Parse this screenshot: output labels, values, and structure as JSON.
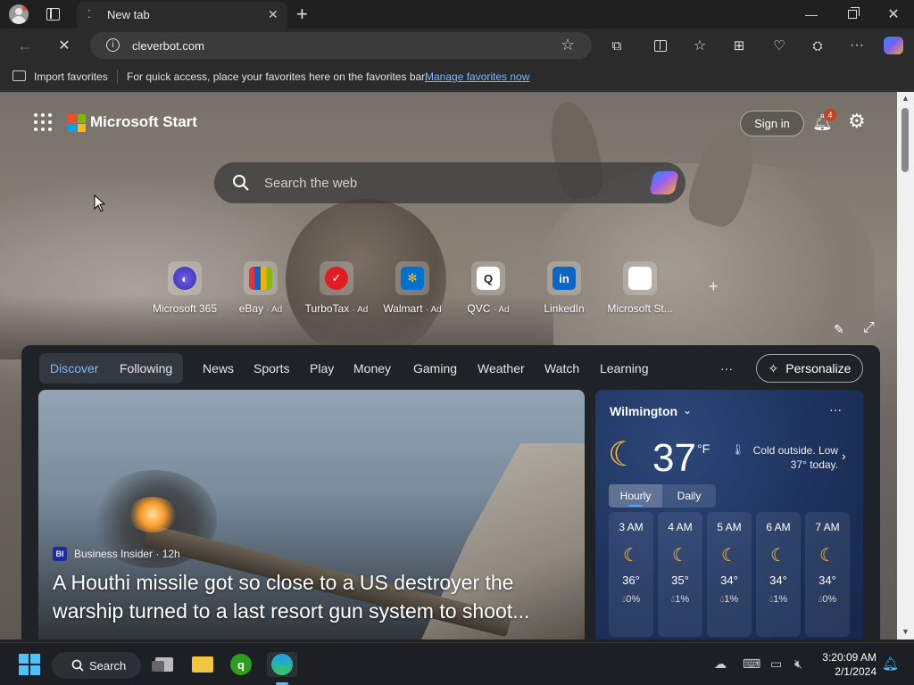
{
  "browser": {
    "tab_title": "New tab",
    "url": "cleverbot.com"
  },
  "favorites_bar": {
    "import_label": "Import favorites",
    "hint": "For quick access, place your favorites here on the favorites bar.",
    "manage_link": "Manage favorites now"
  },
  "header": {
    "brand": "Microsoft Start",
    "sign_in": "Sign in",
    "notification_count": "4"
  },
  "search": {
    "placeholder": "Search the web"
  },
  "quick_links": [
    {
      "label": "Microsoft 365",
      "ad": ""
    },
    {
      "label": "eBay",
      "ad": "· Ad"
    },
    {
      "label": "TurboTax",
      "ad": "· Ad"
    },
    {
      "label": "Walmart",
      "ad": "· Ad"
    },
    {
      "label": "QVC",
      "ad": "· Ad"
    },
    {
      "label": "LinkedIn",
      "ad": ""
    },
    {
      "label": "Microsoft St...",
      "ad": ""
    }
  ],
  "feed_nav": {
    "discover": "Discover",
    "following": "Following",
    "tabs": [
      "News",
      "Sports",
      "Play",
      "Money",
      "Gaming",
      "Weather",
      "Watch",
      "Learning"
    ],
    "more": "···",
    "personalize": "Personalize"
  },
  "hero": {
    "source_logo": "BI",
    "source": "Business Insider · 12h",
    "headline": "A Houthi missile got so close to a US destroyer the warship turned to a last resort gun system to shoot..."
  },
  "weather": {
    "location": "Wilmington",
    "temp": "37",
    "unit": "°F",
    "note": "Cold outside. Low 37° today.",
    "tab_hourly": "Hourly",
    "tab_daily": "Daily",
    "hours": [
      {
        "time": "3 AM",
        "temp": "36°",
        "precip": "0%"
      },
      {
        "time": "4 AM",
        "temp": "35°",
        "precip": "1%"
      },
      {
        "time": "5 AM",
        "temp": "34°",
        "precip": "1%"
      },
      {
        "time": "6 AM",
        "temp": "34°",
        "precip": "1%"
      },
      {
        "time": "7 AM",
        "temp": "34°",
        "precip": "0%"
      }
    ]
  },
  "taskbar": {
    "search_label": "Search",
    "time": "3:20:09 AM",
    "date": "2/1/2024"
  },
  "colors": {
    "accent_link": "#7ab8ff",
    "discover": "#7ab8ff",
    "moon": "#ffc12e",
    "badge": "#c8431c"
  }
}
